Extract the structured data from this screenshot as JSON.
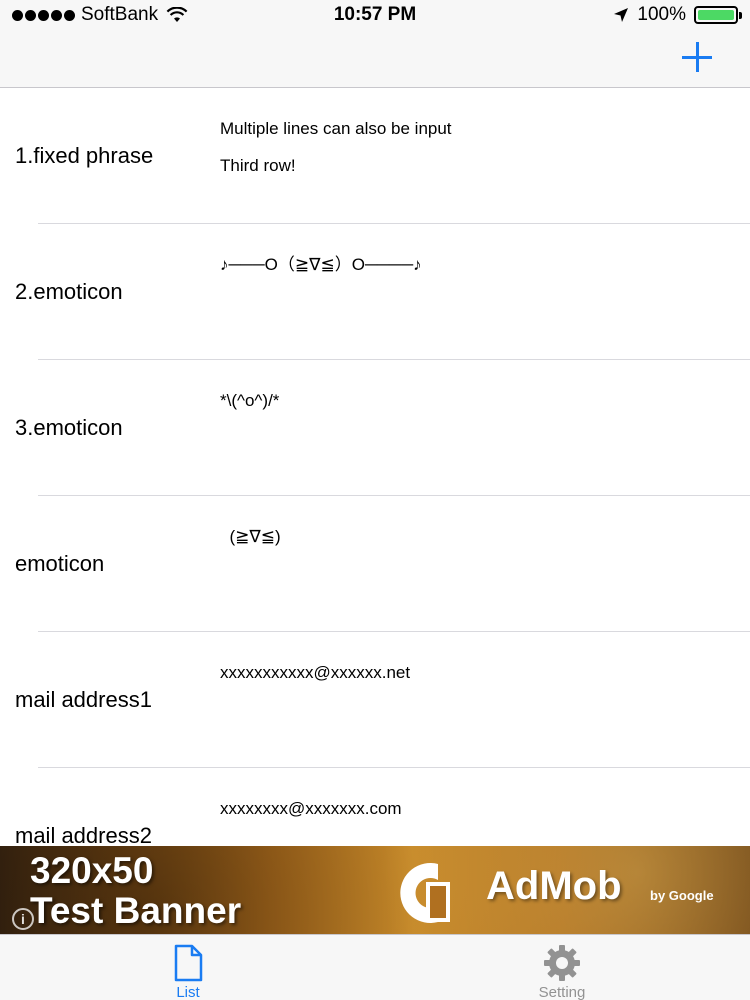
{
  "status_bar": {
    "carrier": "SoftBank",
    "time": "10:57 PM",
    "battery": "100%",
    "battery_color": "#4cd964"
  },
  "nav_bar": {
    "add_icon": "plus-icon",
    "accent_color": "#1a7cf2"
  },
  "list": {
    "items": [
      {
        "title": "1.fixed phrase",
        "content": "Multiple lines can also be input\nThird row!"
      },
      {
        "title": "2.emoticon",
        "content": "♪───O（≧∇≦）O────♪"
      },
      {
        "title": "3.emoticon",
        "content": "*\\(^o^)/*"
      },
      {
        "title": "emoticon",
        "content": "  (≧∇≦)"
      },
      {
        "title": "mail address1",
        "content": "xxxxxxxxxxx@xxxxxx.net"
      },
      {
        "title": "mail address2",
        "content": "xxxxxxxx@xxxxxxx.com"
      }
    ]
  },
  "ad_banner": {
    "line1": "320x50",
    "line2": "Test Banner",
    "brand": "AdMob",
    "by": "by Google"
  },
  "tab_bar": {
    "tabs": [
      {
        "label": "List",
        "icon": "document-icon",
        "selected": true
      },
      {
        "label": "Setting",
        "icon": "gear-icon",
        "selected": false
      }
    ],
    "active_color": "#1a7cf2",
    "inactive_color": "#929292"
  }
}
